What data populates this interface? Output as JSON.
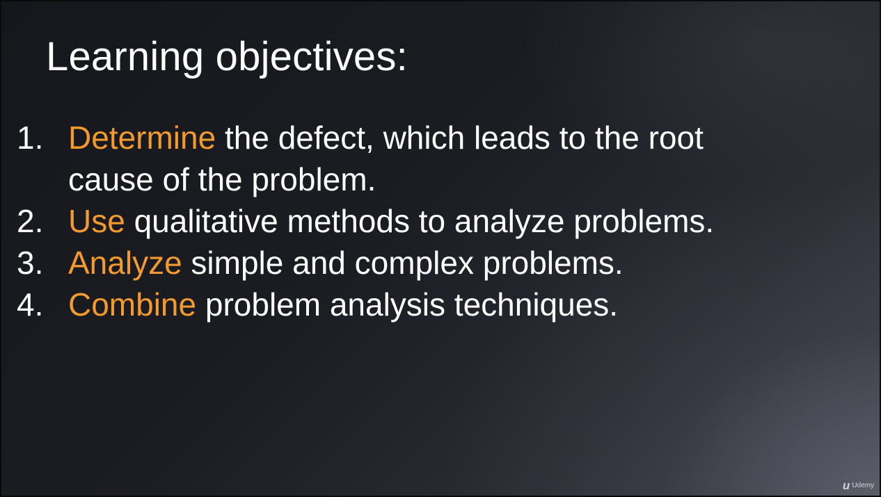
{
  "slide": {
    "title": "Learning objectives:",
    "objectives": [
      {
        "number": "1.",
        "verb": "Determine",
        "rest": " the defect, which leads to the root cause of the problem."
      },
      {
        "number": "2.",
        "verb": "Use",
        "rest": " qualitative methods to analyze problems."
      },
      {
        "number": "3.",
        "verb": "Analyze",
        "rest": " simple and complex problems."
      },
      {
        "number": "4.",
        "verb": "Combine",
        "rest": " problem analysis techniques."
      }
    ],
    "accent_color": "#f39a2f",
    "text_color": "#ffffff"
  },
  "watermark": {
    "mark": "u",
    "text": "Udemy"
  }
}
